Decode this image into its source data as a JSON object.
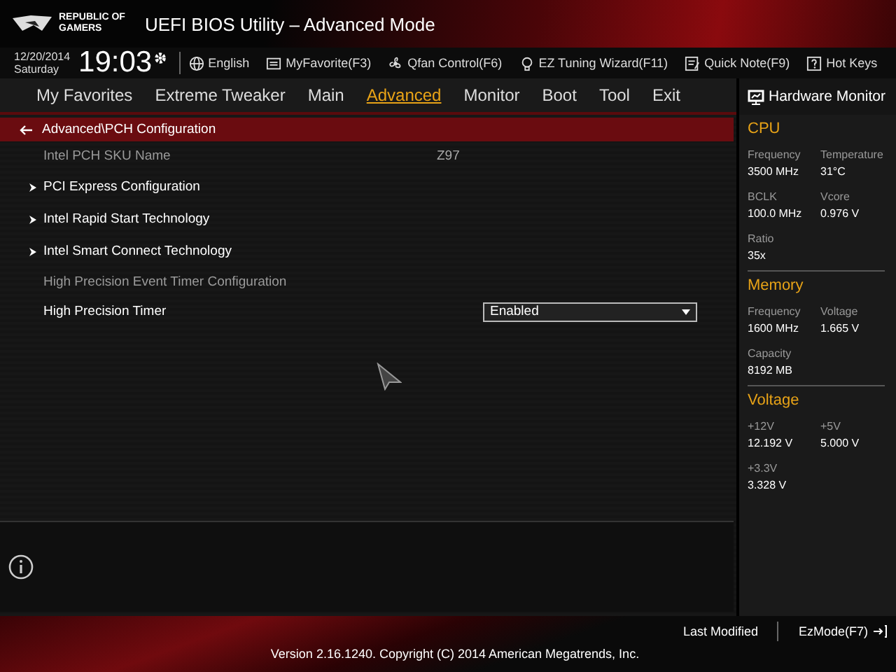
{
  "header": {
    "brand": [
      "REPUBLIC OF",
      "GAMERS"
    ],
    "title": "UEFI BIOS Utility – Advanced Mode"
  },
  "toolbar": {
    "date": "12/20/2014",
    "day": "Saturday",
    "time": "19:03",
    "items": [
      {
        "kind": "globe",
        "label": "English"
      },
      {
        "kind": "favorite",
        "label": "MyFavorite(F3)"
      },
      {
        "kind": "fan",
        "label": "Qfan Control(F6)"
      },
      {
        "kind": "bulb",
        "label": "EZ Tuning Wizard(F11)"
      },
      {
        "kind": "note",
        "label": "Quick Note(F9)"
      },
      {
        "kind": "help",
        "label": "Hot Keys"
      }
    ]
  },
  "tabs": [
    {
      "label": "My Favorites",
      "selected": false
    },
    {
      "label": "Extreme Tweaker",
      "selected": false
    },
    {
      "label": "Main",
      "selected": false
    },
    {
      "label": "Advanced",
      "selected": true
    },
    {
      "label": "Monitor",
      "selected": false
    },
    {
      "label": "Boot",
      "selected": false
    },
    {
      "label": "Tool",
      "selected": false
    },
    {
      "label": "Exit",
      "selected": false
    }
  ],
  "breadcrumb": "Advanced\\PCH Configuration",
  "settings": [
    {
      "kind": "info",
      "label": "Intel PCH SKU Name",
      "value": "Z97"
    },
    {
      "kind": "submenu",
      "label": "PCI Express Configuration"
    },
    {
      "kind": "submenu",
      "label": "Intel Rapid Start Technology"
    },
    {
      "kind": "submenu",
      "label": "Intel Smart Connect Technology"
    },
    {
      "kind": "heading",
      "label": "High Precision Event Timer Configuration"
    },
    {
      "kind": "dropdown",
      "label": "High Precision Timer",
      "value": "Enabled"
    }
  ],
  "hardware_monitor": {
    "title": "Hardware Monitor",
    "sections": [
      {
        "title": "CPU",
        "fields": [
          {
            "label": "Frequency",
            "value": "3500 MHz"
          },
          {
            "label": "Temperature",
            "value": "31°C"
          },
          {
            "label": "BCLK",
            "value": "100.0 MHz"
          },
          {
            "label": "Vcore",
            "value": "0.976 V"
          },
          {
            "label": "Ratio",
            "value": "35x"
          }
        ]
      },
      {
        "title": "Memory",
        "fields": [
          {
            "label": "Frequency",
            "value": "1600 MHz"
          },
          {
            "label": "Voltage",
            "value": "1.665 V"
          },
          {
            "label": "Capacity",
            "value": "8192 MB"
          }
        ]
      },
      {
        "title": "Voltage",
        "fields": [
          {
            "label": "+12V",
            "value": "12.192 V"
          },
          {
            "label": "+5V",
            "value": "5.000 V"
          },
          {
            "label": "+3.3V",
            "value": "3.328 V"
          }
        ]
      }
    ]
  },
  "footer": {
    "last_modified": "Last Modified",
    "ez_mode": "EzMode(F7)",
    "version": "Version 2.16.1240. Copyright (C) 2014 American Megatrends, Inc."
  }
}
